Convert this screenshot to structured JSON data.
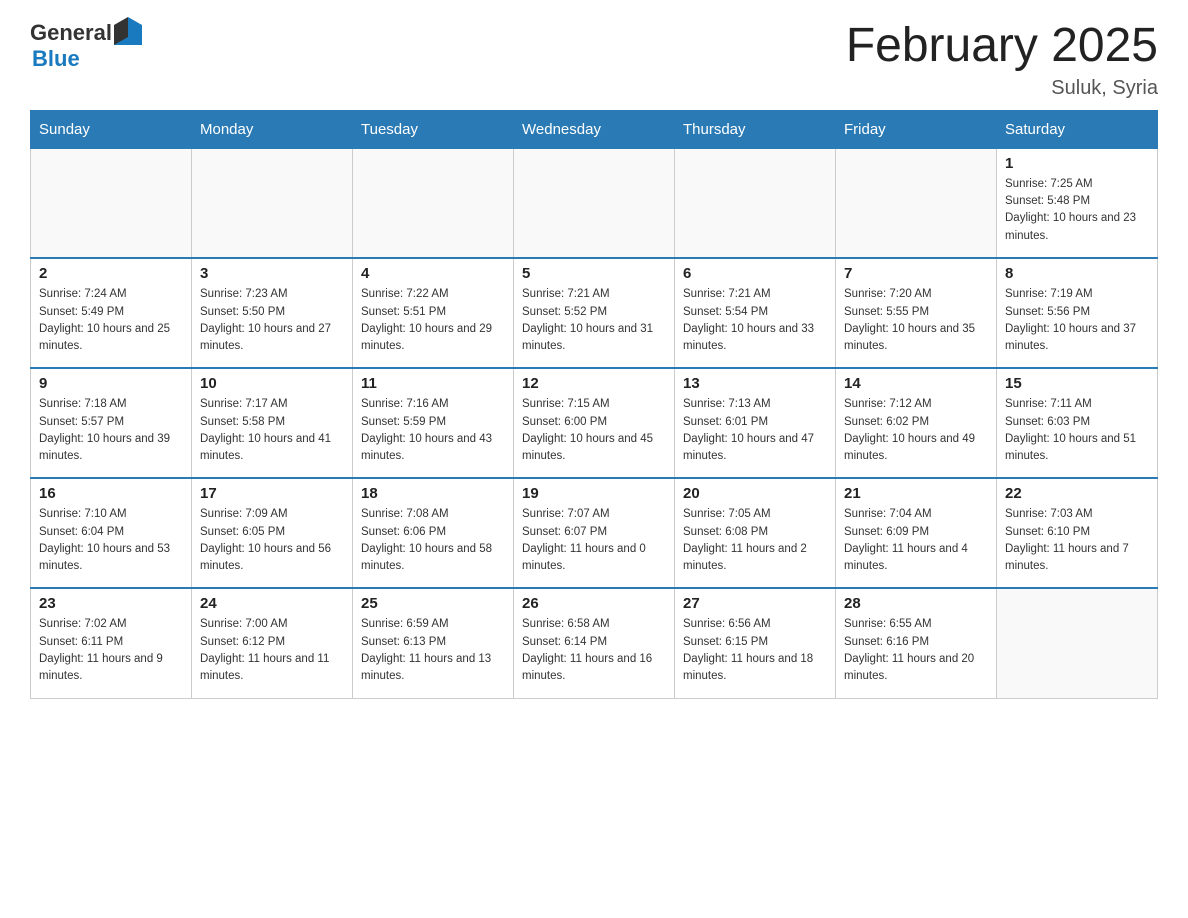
{
  "header": {
    "logo_general": "General",
    "logo_blue": "Blue",
    "title": "February 2025",
    "location": "Suluk, Syria"
  },
  "days_of_week": [
    "Sunday",
    "Monday",
    "Tuesday",
    "Wednesday",
    "Thursday",
    "Friday",
    "Saturday"
  ],
  "weeks": [
    [
      {
        "day": "",
        "sunrise": "",
        "sunset": "",
        "daylight": ""
      },
      {
        "day": "",
        "sunrise": "",
        "sunset": "",
        "daylight": ""
      },
      {
        "day": "",
        "sunrise": "",
        "sunset": "",
        "daylight": ""
      },
      {
        "day": "",
        "sunrise": "",
        "sunset": "",
        "daylight": ""
      },
      {
        "day": "",
        "sunrise": "",
        "sunset": "",
        "daylight": ""
      },
      {
        "day": "",
        "sunrise": "",
        "sunset": "",
        "daylight": ""
      },
      {
        "day": "1",
        "sunrise": "Sunrise: 7:25 AM",
        "sunset": "Sunset: 5:48 PM",
        "daylight": "Daylight: 10 hours and 23 minutes."
      }
    ],
    [
      {
        "day": "2",
        "sunrise": "Sunrise: 7:24 AM",
        "sunset": "Sunset: 5:49 PM",
        "daylight": "Daylight: 10 hours and 25 minutes."
      },
      {
        "day": "3",
        "sunrise": "Sunrise: 7:23 AM",
        "sunset": "Sunset: 5:50 PM",
        "daylight": "Daylight: 10 hours and 27 minutes."
      },
      {
        "day": "4",
        "sunrise": "Sunrise: 7:22 AM",
        "sunset": "Sunset: 5:51 PM",
        "daylight": "Daylight: 10 hours and 29 minutes."
      },
      {
        "day": "5",
        "sunrise": "Sunrise: 7:21 AM",
        "sunset": "Sunset: 5:52 PM",
        "daylight": "Daylight: 10 hours and 31 minutes."
      },
      {
        "day": "6",
        "sunrise": "Sunrise: 7:21 AM",
        "sunset": "Sunset: 5:54 PM",
        "daylight": "Daylight: 10 hours and 33 minutes."
      },
      {
        "day": "7",
        "sunrise": "Sunrise: 7:20 AM",
        "sunset": "Sunset: 5:55 PM",
        "daylight": "Daylight: 10 hours and 35 minutes."
      },
      {
        "day": "8",
        "sunrise": "Sunrise: 7:19 AM",
        "sunset": "Sunset: 5:56 PM",
        "daylight": "Daylight: 10 hours and 37 minutes."
      }
    ],
    [
      {
        "day": "9",
        "sunrise": "Sunrise: 7:18 AM",
        "sunset": "Sunset: 5:57 PM",
        "daylight": "Daylight: 10 hours and 39 minutes."
      },
      {
        "day": "10",
        "sunrise": "Sunrise: 7:17 AM",
        "sunset": "Sunset: 5:58 PM",
        "daylight": "Daylight: 10 hours and 41 minutes."
      },
      {
        "day": "11",
        "sunrise": "Sunrise: 7:16 AM",
        "sunset": "Sunset: 5:59 PM",
        "daylight": "Daylight: 10 hours and 43 minutes."
      },
      {
        "day": "12",
        "sunrise": "Sunrise: 7:15 AM",
        "sunset": "Sunset: 6:00 PM",
        "daylight": "Daylight: 10 hours and 45 minutes."
      },
      {
        "day": "13",
        "sunrise": "Sunrise: 7:13 AM",
        "sunset": "Sunset: 6:01 PM",
        "daylight": "Daylight: 10 hours and 47 minutes."
      },
      {
        "day": "14",
        "sunrise": "Sunrise: 7:12 AM",
        "sunset": "Sunset: 6:02 PM",
        "daylight": "Daylight: 10 hours and 49 minutes."
      },
      {
        "day": "15",
        "sunrise": "Sunrise: 7:11 AM",
        "sunset": "Sunset: 6:03 PM",
        "daylight": "Daylight: 10 hours and 51 minutes."
      }
    ],
    [
      {
        "day": "16",
        "sunrise": "Sunrise: 7:10 AM",
        "sunset": "Sunset: 6:04 PM",
        "daylight": "Daylight: 10 hours and 53 minutes."
      },
      {
        "day": "17",
        "sunrise": "Sunrise: 7:09 AM",
        "sunset": "Sunset: 6:05 PM",
        "daylight": "Daylight: 10 hours and 56 minutes."
      },
      {
        "day": "18",
        "sunrise": "Sunrise: 7:08 AM",
        "sunset": "Sunset: 6:06 PM",
        "daylight": "Daylight: 10 hours and 58 minutes."
      },
      {
        "day": "19",
        "sunrise": "Sunrise: 7:07 AM",
        "sunset": "Sunset: 6:07 PM",
        "daylight": "Daylight: 11 hours and 0 minutes."
      },
      {
        "day": "20",
        "sunrise": "Sunrise: 7:05 AM",
        "sunset": "Sunset: 6:08 PM",
        "daylight": "Daylight: 11 hours and 2 minutes."
      },
      {
        "day": "21",
        "sunrise": "Sunrise: 7:04 AM",
        "sunset": "Sunset: 6:09 PM",
        "daylight": "Daylight: 11 hours and 4 minutes."
      },
      {
        "day": "22",
        "sunrise": "Sunrise: 7:03 AM",
        "sunset": "Sunset: 6:10 PM",
        "daylight": "Daylight: 11 hours and 7 minutes."
      }
    ],
    [
      {
        "day": "23",
        "sunrise": "Sunrise: 7:02 AM",
        "sunset": "Sunset: 6:11 PM",
        "daylight": "Daylight: 11 hours and 9 minutes."
      },
      {
        "day": "24",
        "sunrise": "Sunrise: 7:00 AM",
        "sunset": "Sunset: 6:12 PM",
        "daylight": "Daylight: 11 hours and 11 minutes."
      },
      {
        "day": "25",
        "sunrise": "Sunrise: 6:59 AM",
        "sunset": "Sunset: 6:13 PM",
        "daylight": "Daylight: 11 hours and 13 minutes."
      },
      {
        "day": "26",
        "sunrise": "Sunrise: 6:58 AM",
        "sunset": "Sunset: 6:14 PM",
        "daylight": "Daylight: 11 hours and 16 minutes."
      },
      {
        "day": "27",
        "sunrise": "Sunrise: 6:56 AM",
        "sunset": "Sunset: 6:15 PM",
        "daylight": "Daylight: 11 hours and 18 minutes."
      },
      {
        "day": "28",
        "sunrise": "Sunrise: 6:55 AM",
        "sunset": "Sunset: 6:16 PM",
        "daylight": "Daylight: 11 hours and 20 minutes."
      },
      {
        "day": "",
        "sunrise": "",
        "sunset": "",
        "daylight": ""
      }
    ]
  ]
}
